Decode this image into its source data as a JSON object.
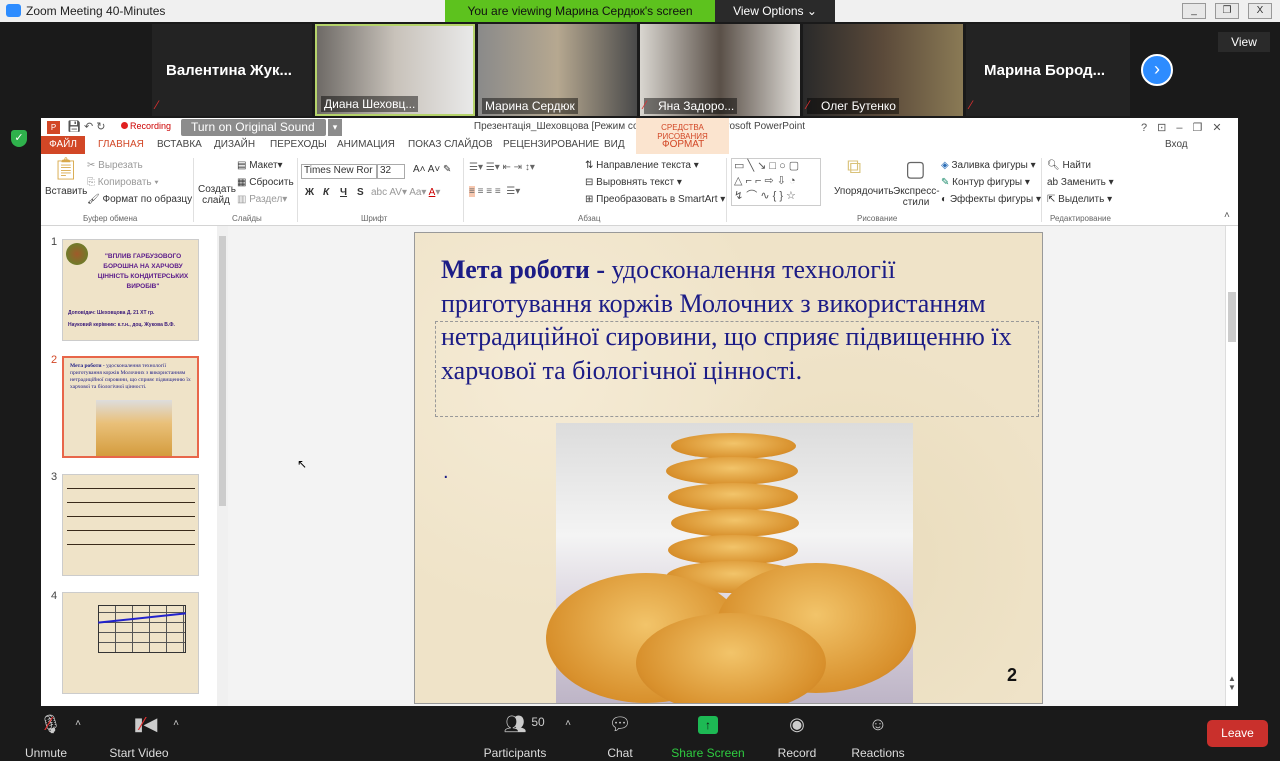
{
  "zoom": {
    "window_title": "Zoom Meeting 40-Minutes",
    "banner": "You are viewing Марина Сердюк's screen",
    "view_options": "View Options ⌄",
    "view": "View",
    "participants": [
      {
        "name": "Валентина  Жук...",
        "muted": true
      },
      {
        "name": "Диана Шеховц...",
        "muted": false
      },
      {
        "name": "Марина Сердюк",
        "muted": false
      },
      {
        "name": "Яна Задоро...",
        "muted": true
      },
      {
        "name": "Олег Бутенко",
        "muted": true
      },
      {
        "name": "Марина  Бород...",
        "muted": true
      }
    ],
    "toolbar": {
      "unmute": "Unmute",
      "start_video": "Start Video",
      "participants": "Participants",
      "participants_count": "50",
      "chat": "Chat",
      "share_screen": "Share Screen",
      "record": "Record",
      "reactions": "Reactions",
      "leave": "Leave"
    },
    "original_sound": "Turn on Original Sound",
    "recording": "Recording"
  },
  "ppt": {
    "title": "Презентація_Шеховцова [Режим совместимости] - Microsoft PowerPoint",
    "drawing_tools": "СРЕДСТВА РИСОВАНИЯ",
    "signin": "Вход",
    "tabs": [
      "ФАЙЛ",
      "ГЛАВНАЯ",
      "ВСТАВКА",
      "ДИЗАЙН",
      "ПЕРЕХОДЫ",
      "АНИМАЦИЯ",
      "ПОКАЗ СЛАЙДОВ",
      "РЕЦЕНЗИРОВАНИЕ",
      "ВИД",
      "ФОРМАТ"
    ],
    "ribbon": {
      "paste": "Вставить",
      "cut": "Вырезать",
      "copy": "Копировать",
      "format_painter": "Формат по образцу",
      "clipboard": "Буфер обмена",
      "new_slide": "Создать слайд",
      "layout": "Макет",
      "reset": "Сбросить",
      "section": "Раздел",
      "slides": "Слайды",
      "font_name": "Times New Ror",
      "font_size": "32",
      "font": "Шрифт",
      "bold": "Ж",
      "italic": "К",
      "underline": "Ч",
      "shadow": "S",
      "text_direction": "Направление текста",
      "align_text": "Выровнять текст",
      "smartart": "Преобразовать в SmartArt",
      "paragraph": "Абзац",
      "arrange": "Упорядочить",
      "quick_styles": "Экспресс-стили",
      "shape_fill": "Заливка фигуры",
      "shape_outline": "Контур фигуры",
      "shape_effects": "Эффекты фигуры",
      "drawing": "Рисование",
      "find": "Найти",
      "replace": "Заменить",
      "select": "Выделить",
      "editing": "Редактирование"
    },
    "thumbnails": [
      {
        "num": "1",
        "title": "\"ВПЛИВ ГАРБУЗОВОГО БОРОШНА НА ХАРЧОВУ ЦІННІСТЬ КОНДИТЕРСЬКИХ ВИРОБІВ\"",
        "line1": "Доповідач: Шеховцова Д. 21 ХТ гр.",
        "line2": "Науковий керівник: к.т.н., доц. Жукова В.Ф."
      },
      {
        "num": "2"
      },
      {
        "num": "3"
      },
      {
        "num": "4"
      }
    ],
    "slide": {
      "bold": "Мета роботи - ",
      "text": "удосконалення технології приготування коржів Молочних з використанням нетрадиційної сировини, що сприяє підвищенню їх харчової та біологічної цінності.",
      "bullet": ".",
      "number": "2"
    }
  }
}
